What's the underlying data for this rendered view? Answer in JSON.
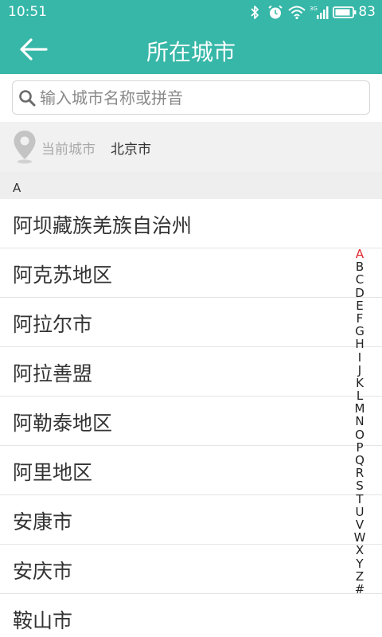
{
  "status_bar": {
    "time": "10:51",
    "battery_percent": "83",
    "icons": [
      "bluetooth-icon",
      "alarm-icon",
      "wifi-icon",
      "signal-3g-icon",
      "battery-icon"
    ]
  },
  "app_bar": {
    "title": "所在城市",
    "back_icon": "arrow-left-icon"
  },
  "search": {
    "placeholder": "输入城市名称或拼音",
    "value": ""
  },
  "current_location": {
    "label": "当前城市",
    "city": "北京市"
  },
  "section": {
    "letter": "A"
  },
  "cities": [
    {
      "name": "阿坝藏族羌族自治州"
    },
    {
      "name": "阿克苏地区"
    },
    {
      "name": "阿拉尔市"
    },
    {
      "name": "阿拉善盟"
    },
    {
      "name": "阿勒泰地区"
    },
    {
      "name": "阿里地区"
    },
    {
      "name": "安康市"
    },
    {
      "name": "安庆市"
    },
    {
      "name": "鞍山市"
    }
  ],
  "index": {
    "letters": [
      "A",
      "B",
      "C",
      "D",
      "E",
      "F",
      "G",
      "H",
      "I",
      "J",
      "K",
      "L",
      "M",
      "N",
      "O",
      "P",
      "Q",
      "R",
      "S",
      "T",
      "U",
      "V",
      "W",
      "X",
      "Y",
      "Z",
      "#"
    ],
    "active": "A"
  },
  "colors": {
    "primary": "#36b7a8",
    "index_active": "#e0272b"
  }
}
